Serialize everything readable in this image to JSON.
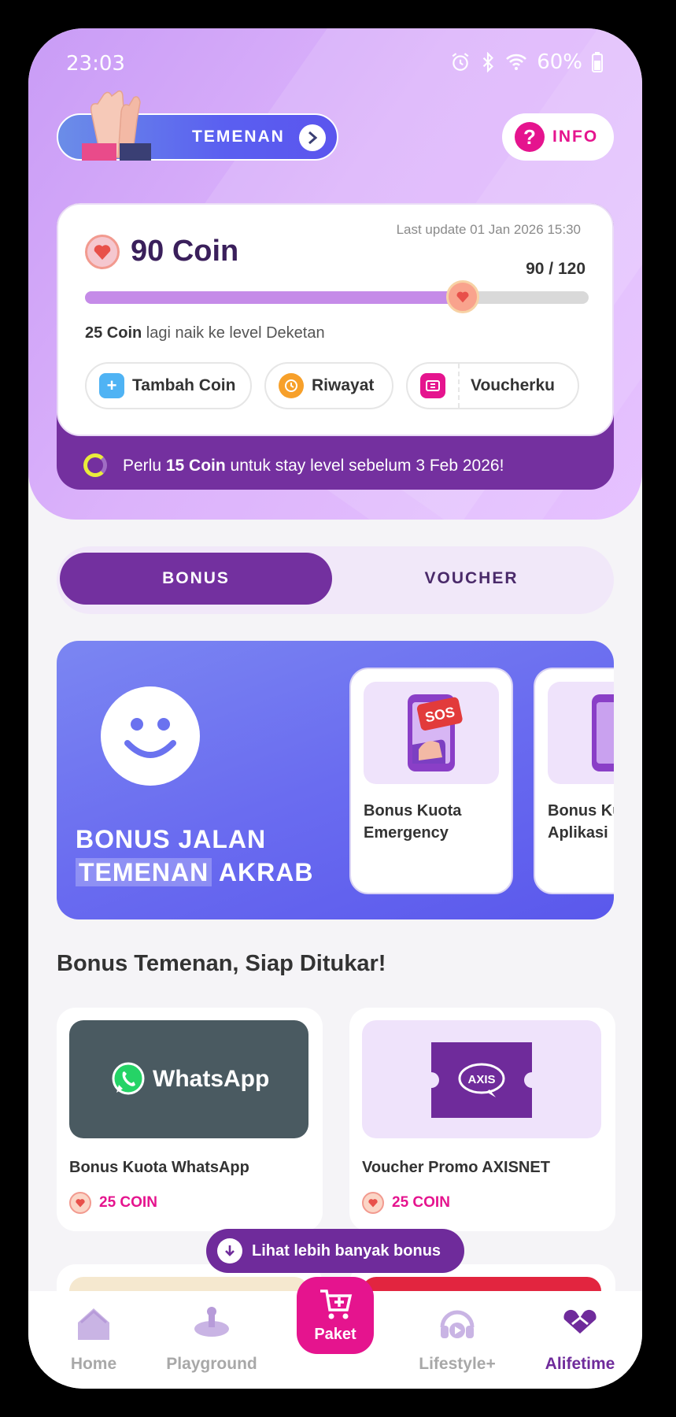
{
  "status_bar": {
    "time": "23:03",
    "battery": "60%"
  },
  "header": {
    "temenan_label": "TEMENAN",
    "info_label": "INFO"
  },
  "coin_card": {
    "last_update": "Last update 01 Jan 2026 15:30",
    "coin_amount": "90 Coin",
    "progress_text": "90 / 120",
    "progress_value": 0.75,
    "level_prefix": "25 Coin",
    "level_suffix": " lagi naik ke level Deketan",
    "actions": {
      "tambah": "Tambah Coin",
      "riwayat": "Riwayat",
      "voucherku": "Voucherku"
    },
    "stay_prefix": "Perlu ",
    "stay_bold": "15 Coin",
    "stay_suffix": " untuk stay level sebelum 3 Feb 2026!"
  },
  "tabs": {
    "bonus": "BONUS",
    "voucher": "VOUCHER"
  },
  "banner": {
    "title_line1": "BONUS JALAN",
    "title_highlight": "TEMENAN",
    "title_rest": " AKRAB",
    "cards": [
      {
        "name": "Bonus Kuota Emergency",
        "sos": "SOS"
      },
      {
        "name": "Bonus Kuota Aplikasi"
      }
    ]
  },
  "section_title": "Bonus Temenan, Siap Ditukar!",
  "products": [
    {
      "thumb_text": "WhatsApp",
      "name": "Bonus  Kuota WhatsApp",
      "price": "25 COIN"
    },
    {
      "thumb_text": "AXIS",
      "name": "Voucher Promo AXISNET",
      "price": "25 COIN"
    }
  ],
  "more_button": "Lihat lebih banyak bonus",
  "bottom_nav": {
    "home": "Home",
    "playground": "Playground",
    "paket": "Paket",
    "lifestyle": "Lifestyle+",
    "alifetime": "Alifetime"
  },
  "colors": {
    "primary_purple": "#73309f",
    "accent_pink": "#e5148e",
    "whatsapp_bg": "#4a5a61"
  }
}
